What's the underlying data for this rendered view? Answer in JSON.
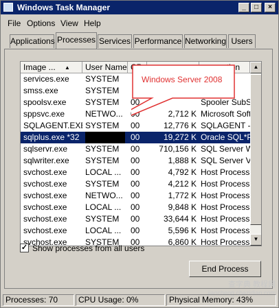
{
  "window": {
    "title": "Windows Task Manager"
  },
  "menu": [
    "File",
    "Options",
    "View",
    "Help"
  ],
  "tabs": [
    "Applications",
    "Processes",
    "Services",
    "Performance",
    "Networking",
    "Users"
  ],
  "active_tab": "Processes",
  "columns": [
    "Image ...",
    "User Name",
    "CP",
    "",
    "ption"
  ],
  "rows": [
    {
      "image": "services.exe",
      "user": "SYSTEM",
      "cpu": "",
      "mem": "",
      "desc": "nd C"
    },
    {
      "image": "smss.exe",
      "user": "SYSTEM",
      "cpu": "",
      "mem": "",
      "desc": "Sessi"
    },
    {
      "image": "spoolsv.exe",
      "user": "SYSTEM",
      "cpu": "00",
      "mem": "",
      "desc": "Spooler SubSy"
    },
    {
      "image": "sppsvc.exe",
      "user": "NETWO...",
      "cpu": "00",
      "mem": "2,712 K",
      "desc": "Microsoft Softw"
    },
    {
      "image": "SQLAGENT.EXE",
      "user": "SYSTEM",
      "cpu": "00",
      "mem": "12,776 K",
      "desc": "SQLAGENT - S"
    },
    {
      "image": "sqlplus.exe *32",
      "user": "",
      "cpu": "00",
      "mem": "19,272 K",
      "desc": "Oracle SQL*Plu",
      "selected": true
    },
    {
      "image": "sqlservr.exe",
      "user": "SYSTEM",
      "cpu": "00",
      "mem": "710,156 K",
      "desc": "SQL Server Wi"
    },
    {
      "image": "sqlwriter.exe",
      "user": "SYSTEM",
      "cpu": "00",
      "mem": "1,888 K",
      "desc": "SQL Server VS"
    },
    {
      "image": "svchost.exe",
      "user": "LOCAL ...",
      "cpu": "00",
      "mem": "4,792 K",
      "desc": "Host Process f"
    },
    {
      "image": "svchost.exe",
      "user": "SYSTEM",
      "cpu": "00",
      "mem": "4,212 K",
      "desc": "Host Process f"
    },
    {
      "image": "svchost.exe",
      "user": "NETWO...",
      "cpu": "00",
      "mem": "1,772 K",
      "desc": "Host Process f"
    },
    {
      "image": "svchost.exe",
      "user": "LOCAL ...",
      "cpu": "00",
      "mem": "9,848 K",
      "desc": "Host Process f"
    },
    {
      "image": "svchost.exe",
      "user": "SYSTEM",
      "cpu": "00",
      "mem": "33,644 K",
      "desc": "Host Process f"
    },
    {
      "image": "svchost.exe",
      "user": "LOCAL ...",
      "cpu": "00",
      "mem": "5,596 K",
      "desc": "Host Process f"
    },
    {
      "image": "svchost.exe",
      "user": "SYSTEM",
      "cpu": "00",
      "mem": "6,860 K",
      "desc": "Host Process f"
    }
  ],
  "callout_text": "Windows  Server 2008",
  "show_all_label": "Show processes from all users",
  "show_all_checked": true,
  "end_process_label": "End Process",
  "status": {
    "processes": "Processes: 70",
    "cpu": "CPU Usage: 0%",
    "memory": "Physical Memory: 43%"
  },
  "watermark": "查字典 教程网",
  "watermark_sub": "jiaocheng.chazidian.com",
  "colors": {
    "selection": "#0a246a",
    "callout": "#e03030",
    "title_bar": "#0a246a"
  }
}
